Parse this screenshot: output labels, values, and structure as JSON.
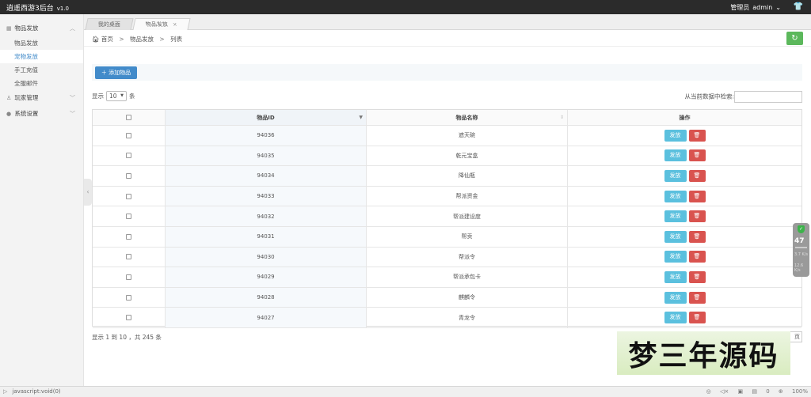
{
  "app": {
    "title": "逍遥西游3后台",
    "version": "v1.0",
    "role": "管理员",
    "username": "admin"
  },
  "sidebar": {
    "groups": [
      {
        "label": "物品发放",
        "items": [
          {
            "label": "物品发放",
            "active": false
          },
          {
            "label": "宠物发放",
            "active": true
          },
          {
            "label": "手工充值",
            "active": false
          },
          {
            "label": "全服邮件",
            "active": false
          }
        ]
      },
      {
        "label": "玩家管理",
        "items": []
      },
      {
        "label": "系统设置",
        "items": []
      }
    ]
  },
  "tabs": [
    {
      "label": "我的桌面",
      "active": false
    },
    {
      "label": "物品发放",
      "active": true,
      "close": "×"
    }
  ],
  "breadcrumb": {
    "home": "首页",
    "section": "物品发放",
    "page": "列表",
    "sep": ">"
  },
  "toolbar": {
    "add_label": "添加物品"
  },
  "table_controls": {
    "show_prefix": "显示",
    "page_size": "10",
    "show_suffix": "条",
    "search_label": "从当前数据中检索:"
  },
  "table": {
    "headers": [
      "",
      "物品ID",
      "物品名称",
      "操作"
    ],
    "issue_label": "发放",
    "rows": [
      {
        "id": "94036",
        "name": "遮天碗"
      },
      {
        "id": "94035",
        "name": "乾元宝盒"
      },
      {
        "id": "94034",
        "name": "降仙瓶"
      },
      {
        "id": "94033",
        "name": "帮派资金"
      },
      {
        "id": "94032",
        "name": "帮派建设度"
      },
      {
        "id": "94031",
        "name": "帮贡"
      },
      {
        "id": "94030",
        "name": "帮派令"
      },
      {
        "id": "94029",
        "name": "帮派承包卡"
      },
      {
        "id": "94028",
        "name": "麒麟令"
      },
      {
        "id": "94027",
        "name": "青龙令"
      }
    ]
  },
  "summary": "显示 1 到 10 ，共 245 条",
  "pager": {
    "last_char": "页"
  },
  "watermark": {
    "text": "梦三年源码"
  },
  "float_widget": {
    "value": "47",
    "up": "3.7 K/s",
    "down": "12.6 K/s"
  },
  "statusbar": {
    "url": "javascript:void(0)",
    "zoom": "100%",
    "badge_count": "0"
  },
  "colors": {
    "primary": "#428bca",
    "info": "#5bc0de",
    "danger": "#d9534f",
    "success": "#5cb85c",
    "topbar": "#2b2b2b"
  }
}
